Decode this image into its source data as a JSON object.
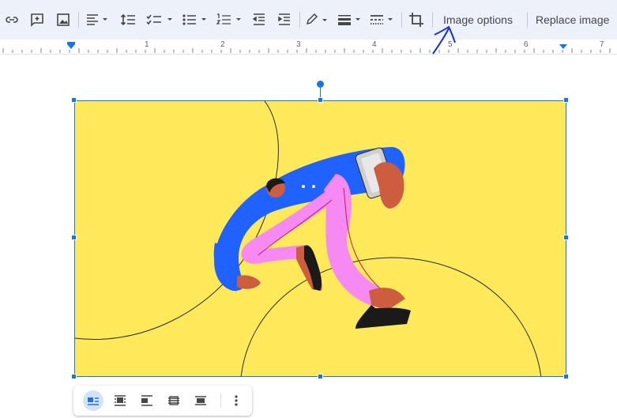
{
  "toolbar": {
    "image_options_label": "Image options",
    "replace_image_label": "Replace image"
  },
  "ruler": {
    "numbers": [
      "1",
      "2",
      "3",
      "4",
      "5",
      "6",
      "7"
    ]
  },
  "colors": {
    "toolbar_bg": "#edf2fa",
    "selection_blue": "#1a73e8",
    "image_bg": "#fde95a",
    "figure_blue": "#1f62ff",
    "figure_pink": "#f78af2",
    "skin": "#cc5d3f",
    "annotation_ink": "#1c2fc9"
  },
  "icons": {
    "toolbar": [
      "link-icon",
      "add-comment-icon",
      "insert-image-icon",
      "align-icon",
      "line-spacing-icon",
      "checklist-icon",
      "bulleted-list-icon",
      "numbered-list-icon",
      "decrease-indent-icon",
      "increase-indent-icon",
      "border-color-icon",
      "border-weight-icon",
      "border-dash-icon",
      "crop-icon"
    ],
    "float_bar": [
      "inline-icon",
      "wrap-text-icon",
      "break-text-icon",
      "behind-text-icon",
      "in-front-of-text-icon",
      "more-options-icon"
    ]
  },
  "float_bar": {
    "active_option": "inline"
  }
}
